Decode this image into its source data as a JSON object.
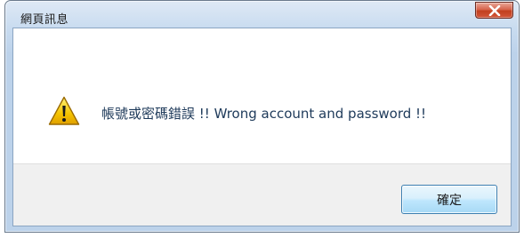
{
  "window": {
    "title": "網頁訊息",
    "close_icon": "close-x-icon"
  },
  "dialog": {
    "icon": "warning-triangle-icon",
    "message": "帳號或密碼錯誤 !! Wrong account and password !!",
    "ok_label": "確定"
  },
  "colors": {
    "close_button": "#d2563a",
    "message_text": "#1e3a5a",
    "warning_yellow": "#f5c400",
    "button_border": "#3c7fb1"
  }
}
